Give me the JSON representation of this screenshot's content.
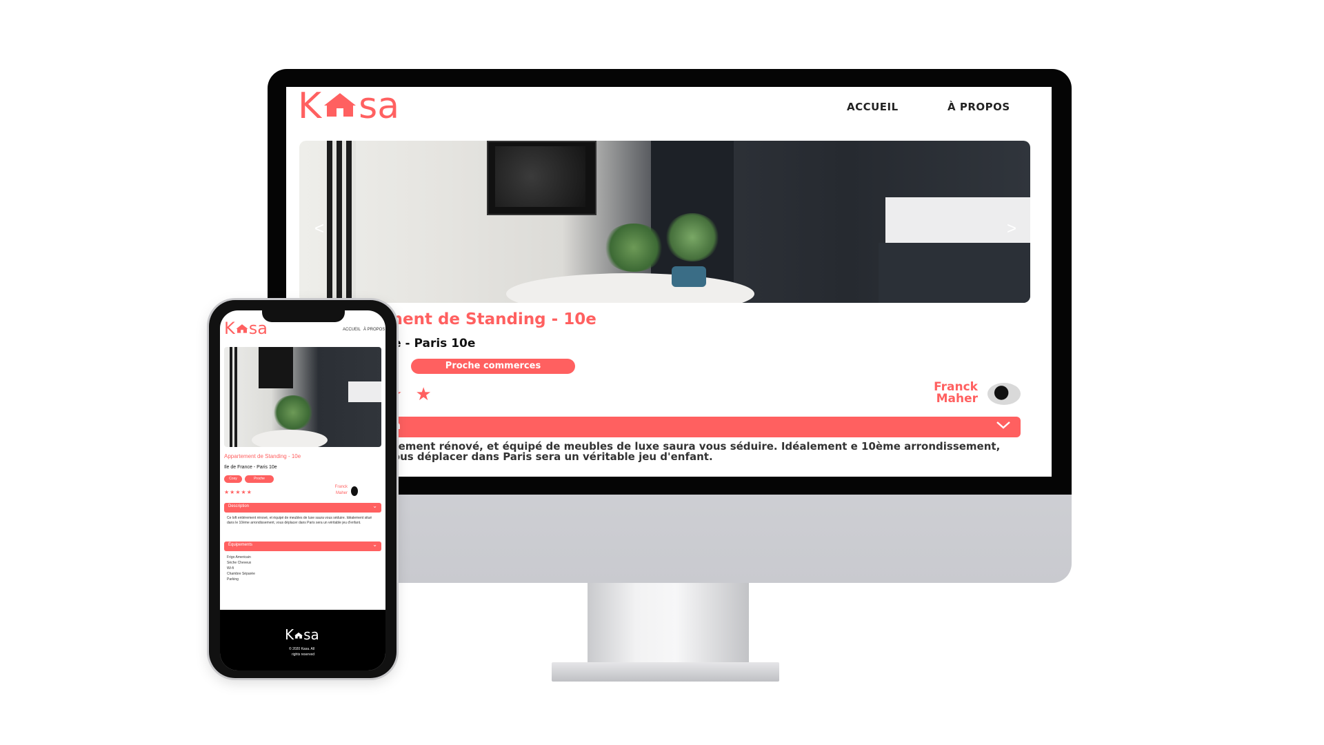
{
  "brand": {
    "logo_left": "K",
    "logo_right": "sa",
    "accent": "#ff6060"
  },
  "desktop": {
    "nav": {
      "home": "ACCUEIL",
      "about": "À PROPOS"
    },
    "carousel": {
      "prev": "<",
      "next": ">"
    },
    "title": "ment de Standing - 10e",
    "location": "ce - Paris 10e",
    "tag": "Proche commerces",
    "stars": "★ ★",
    "host": {
      "first": "Franck",
      "last": "Maher"
    },
    "description_label": "on",
    "description": "èrement rénové, et équipé de meubles de luxe saura vous séduire. Idéalement e 10ème arrondissement, vous déplacer dans Paris sera un véritable jeu d'enfant."
  },
  "mobile": {
    "nav": {
      "home": "ACCUEIL",
      "about": "À PROPOS"
    },
    "title": "Appartement de Standing - 10e",
    "location": "Ile de France - Paris 10e",
    "tags": [
      "Cosy",
      "Proche commerces"
    ],
    "stars": "★★★★★",
    "host": {
      "first": "Franck",
      "last": "Maher"
    },
    "description_label": "Description",
    "description": "Ce loft entièrement rénové, et équipé de meubles de luxe saura vous séduire. Idéalement situé dans le 10ème arrondissement, vous déplacer dans Paris sera un véritable jeu d'enfant.",
    "equipment_label": "Équipements",
    "equipments": [
      "Frigo Americain",
      "Sèche Cheveux",
      "Wi-fi",
      "Chambre Séparée",
      "Parking"
    ],
    "footer_logo_left": "K",
    "footer_logo_right": "sa",
    "copyright_line1": "© 2020 Kasa. All",
    "copyright_line2": "rights reserved"
  },
  "icons": {
    "chevron": "chevron-down-icon",
    "house": "house-icon"
  }
}
